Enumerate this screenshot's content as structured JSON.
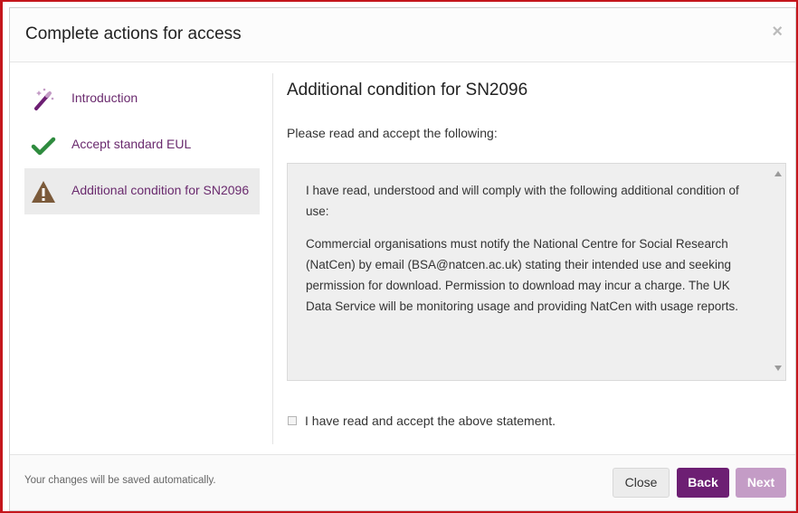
{
  "modal": {
    "title": "Complete actions for access",
    "close_symbol": "×"
  },
  "sidebar": {
    "items": [
      {
        "label": "Introduction",
        "icon": "magic-wand-icon",
        "active": false
      },
      {
        "label": "Accept standard EUL",
        "icon": "checkmark-icon",
        "active": false
      },
      {
        "label": "Additional condition for SN2096",
        "icon": "warning-icon",
        "active": true
      }
    ]
  },
  "content": {
    "title": "Additional condition for SN2096",
    "instruction": "Please read and accept the following:",
    "paragraphs": [
      "I have read, understood and will comply with the following additional condition of use:",
      "Commercial organisations must notify the National Centre for Social Research (NatCen) by email (BSA@natcen.ac.uk) stating their intended use and seeking permission for download. Permission to download may incur a charge. The UK Data Service will be monitoring usage and providing NatCen with usage reports."
    ],
    "checkbox_label": "I have read and accept the above statement.",
    "checkbox_checked": false
  },
  "footer": {
    "note": "Your changes will be saved automatically.",
    "close_label": "Close",
    "back_label": "Back",
    "next_label": "Next"
  },
  "colors": {
    "accent_purple": "#6d1f73",
    "disabled_purple": "#c49cc6",
    "link_purple": "#6a2a6e",
    "check_green": "#2e8b3e",
    "warning_brown": "#7b5a3a",
    "frame_red": "#c4161c"
  }
}
